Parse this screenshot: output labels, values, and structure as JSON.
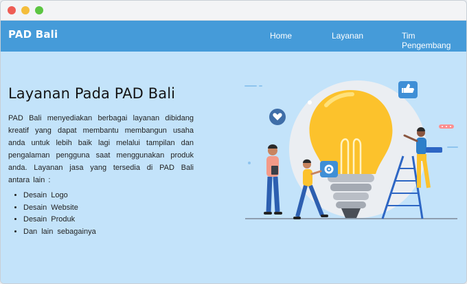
{
  "nav": {
    "brand": "PAD Bali",
    "links": [
      "Home",
      "Layanan",
      "Tim Pengembang"
    ]
  },
  "hero": {
    "title": "Layanan Pada PAD Bali",
    "description": "PAD Bali menyediakan berbagai layanan dibidang kreatif yang dapat membantu membangun usaha anda untuk lebih baik lagi melalui tampilan dan pengalaman pengguna saat menggunakan produk anda. Layanan jasa yang tersedia di PAD Bali antara lain :",
    "services": [
      "Desain Logo",
      "Desain Website",
      "Desain Produk",
      "Dan lain sebagainya"
    ]
  },
  "colors": {
    "navbar": "#459bd9",
    "background": "#c3e3fa",
    "bulb": "#fcc22c",
    "accent_blue": "#3f8fd6"
  },
  "icons": [
    "heart-icon",
    "thumbs-up-icon",
    "gear-icon",
    "lightbulb-icon",
    "ladder-icon"
  ]
}
